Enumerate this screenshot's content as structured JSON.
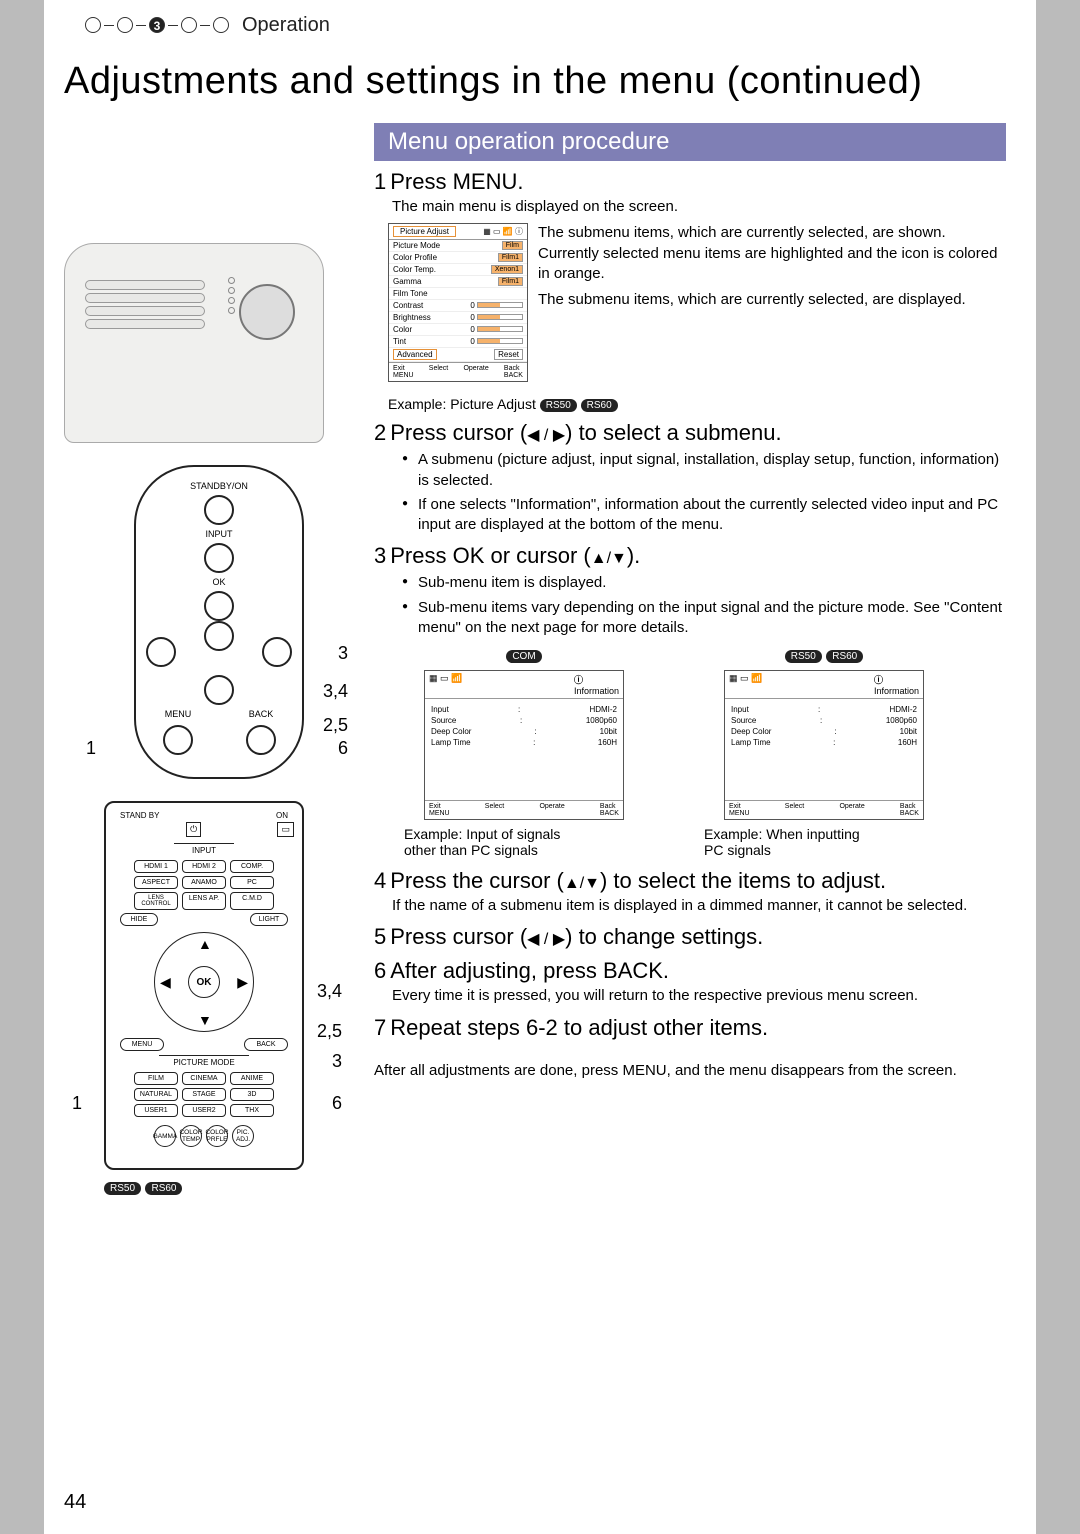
{
  "header": {
    "section": "Operation",
    "stepnum": "3"
  },
  "title": "Adjustments and settings in the menu (continued)",
  "sectionBar": "Menu operation procedure",
  "models": {
    "a": "RS50",
    "b": "RS60",
    "c": "COM"
  },
  "steps": {
    "s1": {
      "num": "1",
      "head": "Press MENU.",
      "sub": "The main menu is displayed on the screen.",
      "callout1": "The submenu items, which are currently selected, are shown. Currently selected menu items are highlighted and the icon is colored in orange.",
      "callout2": "The submenu items, which are currently selected, are displayed.",
      "example": "Example: Picture Adjust"
    },
    "s2": {
      "num": "2",
      "head_a": "Press cursor  (",
      "head_b": ") to select a submenu.",
      "b1": "A submenu (picture adjust, input signal, installation, display setup, function, information) is selected.",
      "b2": "If one selects \"Information\", information about the currently selected video input and PC input  are displayed at the bottom of the menu."
    },
    "s3": {
      "num": "3",
      "head_a": "Press OK or cursor (",
      "head_b": ").",
      "b1": "Sub-menu item is displayed.",
      "b2": "Sub-menu items vary depending on the input signal and the picture mode. See \"Content menu\" on the next page for more details.",
      "cap1a": "Example: Input of signals",
      "cap1b": "other than PC signals",
      "cap2a": "Example: When inputting",
      "cap2b": "PC signals"
    },
    "s4": {
      "num": "4",
      "head_a": "Press the cursor (",
      "head_b": ") to select the items to adjust.",
      "sub": "If the name of a submenu item is displayed in a dimmed manner, it cannot be selected."
    },
    "s5": {
      "num": "5",
      "head_a": "Press cursor (",
      "head_b": ") to change settings."
    },
    "s6": {
      "num": "6",
      "head": "After adjusting, press BACK.",
      "sub": "Every time it is pressed, you will return to the respective previous menu screen."
    },
    "s7": {
      "num": "7",
      "head": "Repeat steps 6-2 to adjust other items."
    }
  },
  "closing": "After all adjustments are done, press MENU, and the menu disappears from the screen.",
  "pageNum": "44",
  "osdMenu": {
    "title": "Picture Adjust",
    "rows": [
      {
        "k": "Picture Mode",
        "v": "Film"
      },
      {
        "k": "Color Profile",
        "v": "Film1"
      },
      {
        "k": "Color Temp.",
        "v": "Xenon1"
      },
      {
        "k": "Gamma",
        "v": "Film1"
      },
      {
        "k": "Film Tone",
        "v": ""
      },
      {
        "k": "Contrast",
        "v": "0"
      },
      {
        "k": "Brightness",
        "v": "0"
      },
      {
        "k": "Color",
        "v": "0"
      },
      {
        "k": "Tint",
        "v": "0"
      }
    ],
    "advanced": "Advanced",
    "reset": "Reset",
    "exit": "Exit",
    "menu": "MENU",
    "select": "Select",
    "operate": "Operate",
    "back": "Back",
    "backbtn": "BACK",
    "info": "Information"
  },
  "infoBox": {
    "rows": [
      {
        "k": "Input",
        "v": "HDMI-2"
      },
      {
        "k": "Source",
        "v": "1080p60"
      },
      {
        "k": "Deep Color",
        "v": "10bit"
      },
      {
        "k": "Lamp Time",
        "v": "160H"
      }
    ]
  },
  "ctrlPanel": {
    "standby": "STANDBY/ON",
    "input": "INPUT",
    "ok": "OK",
    "menu": "MENU",
    "back": "BACK",
    "call_left": "1",
    "call_r1": "3",
    "call_r2": "3,4",
    "call_r3": "2,5",
    "call_r4": "6"
  },
  "remote": {
    "standby": "STAND BY",
    "on": "ON",
    "input": "INPUT",
    "row1": [
      "HDMI 1",
      "HDMI 2",
      "COMP."
    ],
    "row2": [
      "ASPECT",
      "ANAMO",
      "PC"
    ],
    "row3": [
      "LENS CONTROL",
      "LENS AP.",
      "C.M.D"
    ],
    "hide": "HIDE",
    "light": "LIGHT",
    "ok": "OK",
    "menu": "MENU",
    "back": "BACK",
    "pmode": "PICTURE MODE",
    "pm1": [
      "FILM",
      "CINEMA",
      "ANIME"
    ],
    "pm2": [
      "NATURAL",
      "STAGE",
      "3D"
    ],
    "pm3": [
      "USER1",
      "USER2",
      "THX"
    ],
    "rounds": [
      "GAMMA",
      "COLOR TEMP",
      "COLOR PRFLE",
      "PIC. ADJ."
    ],
    "call_left": "1",
    "call_r1": "3,4",
    "call_r2": "2,5",
    "call_r3": "3",
    "call_r4": "6"
  }
}
